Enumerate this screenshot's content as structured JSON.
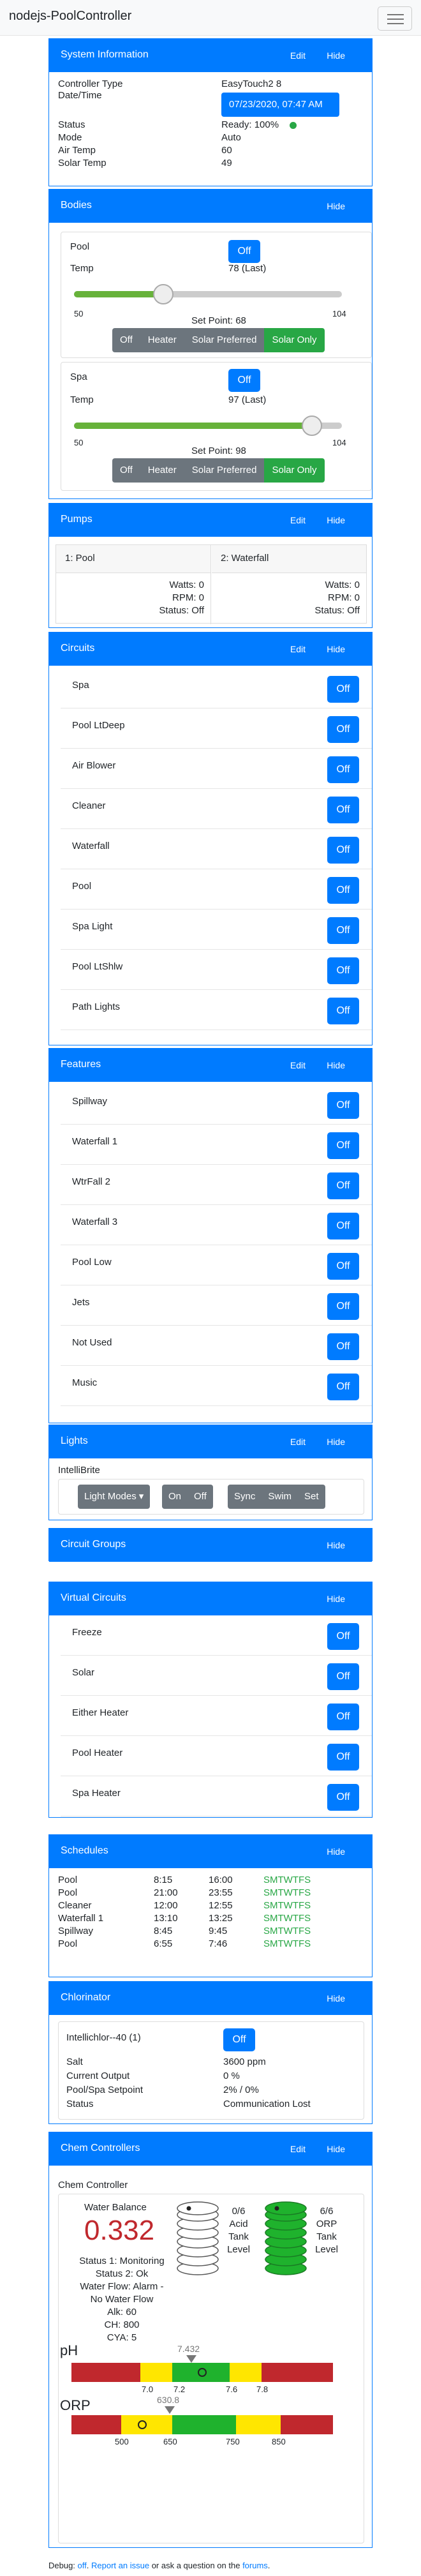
{
  "brand": "nodejs-PoolController",
  "common": {
    "edit": "Edit",
    "hide": "Hide",
    "off": "Off"
  },
  "sysinfo": {
    "title": "System Information",
    "controller_label": "Controller Type",
    "controller_value": "EasyTouch2 8",
    "datetime_label": "Date/Time",
    "datetime_value": "07/23/2020, 07:47 AM",
    "status_label": "Status",
    "status_value": "Ready: 100%",
    "mode_label": "Mode",
    "mode_value": "Auto",
    "airtemp_label": "Air Temp",
    "airtemp_value": "60",
    "solartemp_label": "Solar Temp",
    "solartemp_value": "49"
  },
  "bodies": {
    "title": "Bodies",
    "temp_label": "Temp",
    "min": "50",
    "max": "104",
    "modes": [
      "Off",
      "Heater",
      "Solar Preferred",
      "Solar Only"
    ],
    "pool": {
      "name": "Pool",
      "temp": "78 (Last)",
      "setpoint": "Set Point: 68",
      "setpoint_value": 68
    },
    "spa": {
      "name": "Spa",
      "temp": "97 (Last)",
      "setpoint": "Set Point: 98",
      "setpoint_value": 98
    }
  },
  "pumps": {
    "title": "Pumps",
    "p1": {
      "name": "1: Pool",
      "watts": "Watts: 0",
      "rpm": "RPM: 0",
      "status": "Status: Off"
    },
    "p2": {
      "name": "2: Waterfall",
      "watts": "Watts: 0",
      "rpm": "RPM: 0",
      "status": "Status: Off"
    }
  },
  "circuits": {
    "title": "Circuits",
    "items": [
      "Spa",
      "Pool LtDeep",
      "Air Blower",
      "Cleaner",
      "Waterfall",
      "Pool",
      "Spa Light",
      "Pool LtShlw",
      "Path Lights"
    ]
  },
  "features": {
    "title": "Features",
    "items": [
      "Spillway",
      "Waterfall 1",
      "WtrFall 2",
      "Waterfall 3",
      "Pool Low",
      "Jets",
      "Not Used",
      "Music"
    ]
  },
  "lights": {
    "title": "Lights",
    "name": "IntelliBrite",
    "modes_button": "Light Modes",
    "buttons": [
      "On",
      "Off",
      "Sync",
      "Swim",
      "Set"
    ]
  },
  "circuit_groups": {
    "title": "Circuit Groups"
  },
  "virtual": {
    "title": "Virtual Circuits",
    "items": [
      "Freeze",
      "Solar",
      "Either Heater",
      "Pool Heater",
      "Spa Heater"
    ]
  },
  "schedules": {
    "title": "Schedules",
    "rows": [
      {
        "name": "Pool",
        "start": "8:15",
        "end": "16:00",
        "days": "SMTWTFS"
      },
      {
        "name": "Pool",
        "start": "21:00",
        "end": "23:55",
        "days": "SMTWTFS"
      },
      {
        "name": "Cleaner",
        "start": "12:00",
        "end": "12:55",
        "days": "SMTWTFS"
      },
      {
        "name": "Waterfall 1",
        "start": "13:10",
        "end": "13:25",
        "days": "SMTWTFS"
      },
      {
        "name": "Spillway",
        "start": "8:45",
        "end": "9:45",
        "days": "SMTWTFS"
      },
      {
        "name": "Pool",
        "start": "6:55",
        "end": "7:46",
        "days": "SMTWTFS"
      }
    ]
  },
  "chlorinator": {
    "title": "Chlorinator",
    "name": "Intellichlor--40 (1)",
    "salt_label": "Salt",
    "salt_value": "3600 ppm",
    "output_label": "Current Output",
    "output_value": "0 %",
    "setpoint_label": "Pool/Spa Setpoint",
    "setpoint_value": "2% / 0%",
    "status_label": "Status",
    "status_value": "Communication Lost"
  },
  "chem": {
    "title": "Chem Controllers",
    "name": "Chem Controller",
    "wb_label": "Water Balance",
    "wb_value": "0.332",
    "acid_count": "0/6",
    "acid_label1": "Acid",
    "acid_label2": "Tank",
    "acid_label3": "Level",
    "orp_count": "6/6",
    "orp_label1": "ORP",
    "orp_label2": "Tank",
    "orp_label3": "Level",
    "status1": "Status 1: Monitoring",
    "status2": "Status 2: Ok",
    "flow1": "Water Flow: Alarm -",
    "flow2": "No Water Flow",
    "alk": "Alk: 60",
    "ch": "CH: 800",
    "cya": "CYA: 5",
    "ph_label": "pH",
    "ph_value": "7.432",
    "ph_ticks": [
      "7.0",
      "7.2",
      "7.6",
      "7.8"
    ],
    "orp_label": "ORP",
    "orp_value": "630.8",
    "orp_ticks": [
      "500",
      "650",
      "750",
      "850"
    ]
  },
  "footer": {
    "debug": "Debug: ",
    "debug_state": "off",
    "period": ".",
    "report": "Report an issue",
    "middle": " or ask a question on the ",
    "forums": "forums",
    "end": "."
  },
  "colors": {
    "primary": "#007bff",
    "success": "#28a745",
    "secondary": "#6c757d",
    "danger": "#c0282d"
  }
}
